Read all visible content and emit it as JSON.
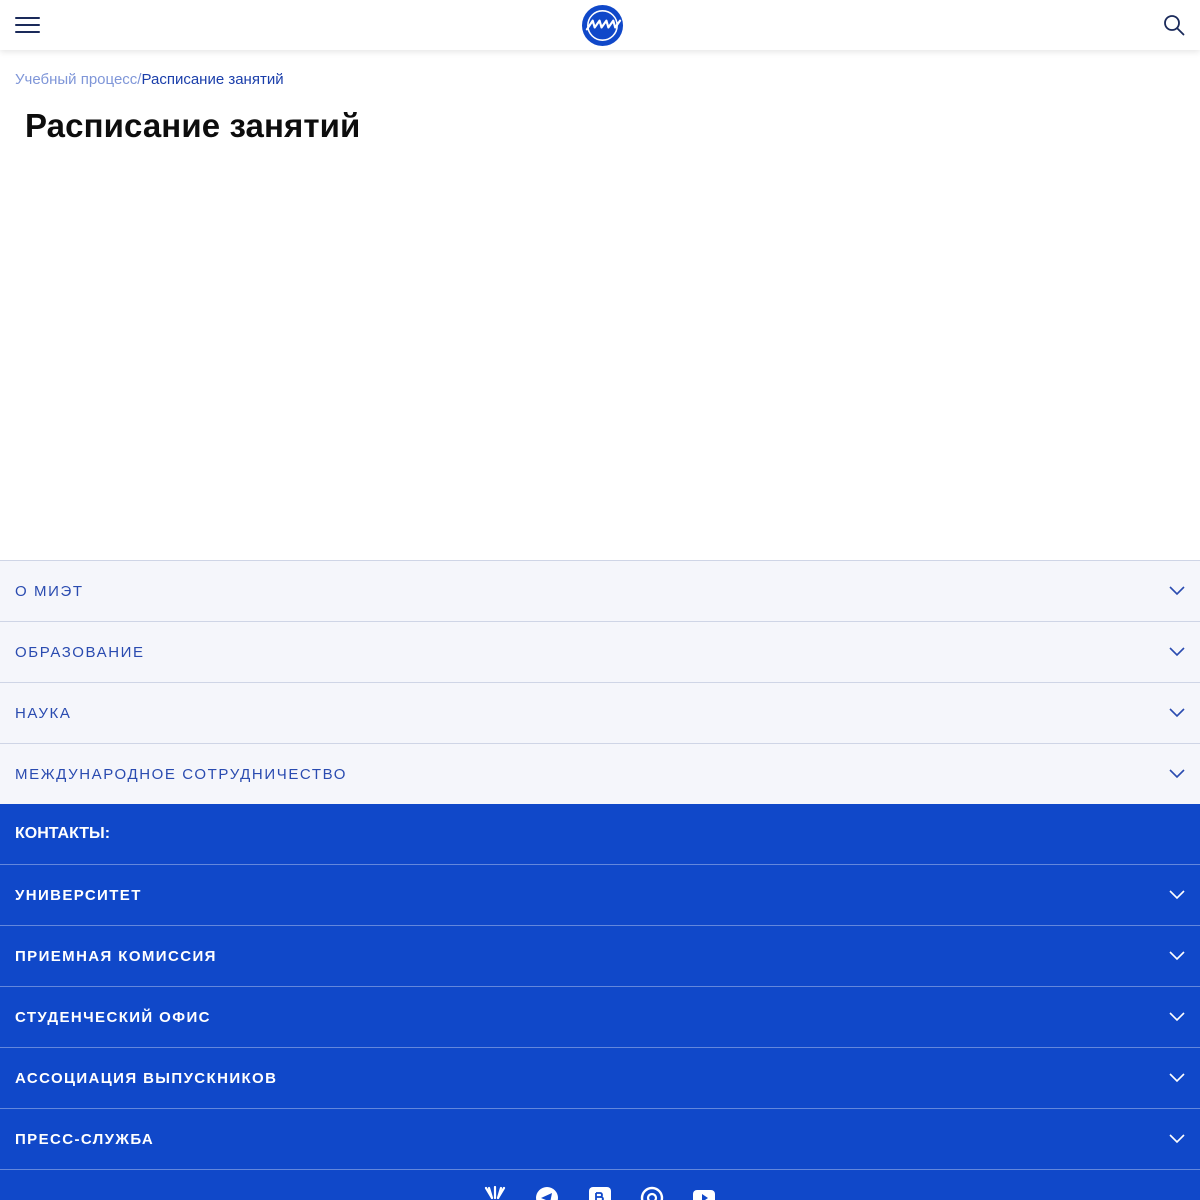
{
  "header": {
    "menu_icon": "hamburger-menu-icon",
    "logo_icon": "miet-logo",
    "search_icon": "search-icon"
  },
  "breadcrumb": {
    "parent": "Учебный процесс",
    "separator": "/",
    "current": "Расписание занятий"
  },
  "page": {
    "title": "Расписание занятий"
  },
  "nav": {
    "items": [
      {
        "label": "О МИЭТ"
      },
      {
        "label": "ОБРАЗОВАНИЕ"
      },
      {
        "label": "НАУКА"
      },
      {
        "label": "МЕЖДУНАРОДНОЕ СОТРУДНИЧЕСТВО"
      }
    ]
  },
  "footer": {
    "contacts_title": "КОНТАКТЫ:",
    "items": [
      {
        "label": "УНИВЕРСИТЕТ"
      },
      {
        "label": "ПРИЕМНАЯ КОМИССИЯ"
      },
      {
        "label": "СТУДЕНЧЕСКИЙ ОФИС"
      },
      {
        "label": "АССОЦИАЦИЯ ВЫПУСКНИКОВ"
      },
      {
        "label": "ПРЕСС-СЛУЖБА"
      }
    ],
    "social": [
      "zhzh-icon",
      "telegram-icon",
      "vk-icon",
      "ok-icon",
      "youtube-icon"
    ]
  },
  "colors": {
    "brand_blue": "#1048c9",
    "link_blue": "#2a4bb0",
    "breadcrumb_muted": "#7f96d8",
    "nav_background": "#f5f6fb"
  }
}
